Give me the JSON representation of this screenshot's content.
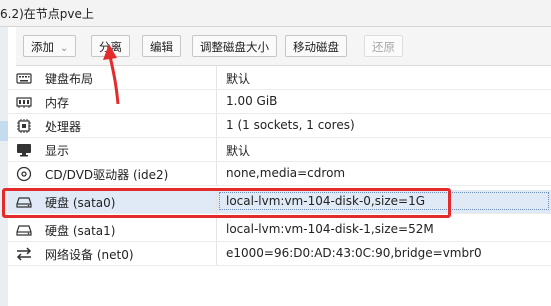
{
  "header": {
    "title": "6.2)在节点pve上"
  },
  "toolbar": {
    "add_label": "添加",
    "detach_label": "分离",
    "edit_label": "编辑",
    "resize_label": "调整磁盘大小",
    "move_label": "移动磁盘",
    "revert_label": "还原"
  },
  "rows": [
    {
      "icon": "keyboard-icon",
      "label": "键盘布局",
      "value": "默认"
    },
    {
      "icon": "memory-icon",
      "label": "内存",
      "value": "1.00 GiB"
    },
    {
      "icon": "cpu-icon",
      "label": "处理器",
      "value": "1 (1 sockets, 1 cores)"
    },
    {
      "icon": "monitor-icon",
      "label": "显示",
      "value": "默认"
    },
    {
      "icon": "cdrom-icon",
      "label": "CD/DVD驱动器 (ide2)",
      "value": "none,media=cdrom"
    },
    {
      "icon": "harddisk-icon",
      "label": "硬盘 (sata0)",
      "value": "local-lvm:vm-104-disk-0,size=1G"
    },
    {
      "icon": "harddisk-icon",
      "label": "硬盘 (sata1)",
      "value": "local-lvm:vm-104-disk-1,size=52M"
    },
    {
      "icon": "network-icon",
      "label": "网络设备 (net0)",
      "value": "e1000=96:D0:AD:43:0C:90,bridge=vmbr0"
    }
  ],
  "colors": {
    "annotation": "#e32b2b",
    "selection": "#dfeaf6"
  }
}
